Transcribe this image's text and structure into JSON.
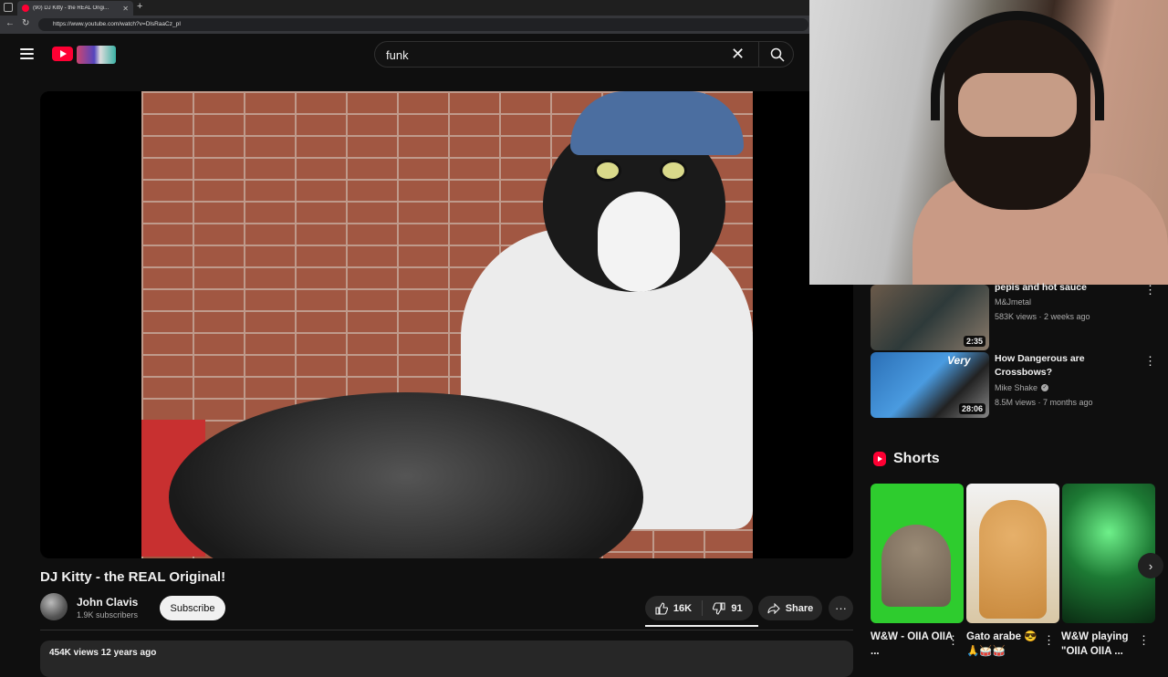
{
  "browser": {
    "tab_title": "(90) DJ Kitty - the REAL Origi...",
    "url": "https://www.youtube.com/watch?v=DlsRaaCz_pI"
  },
  "search": {
    "query": "funk"
  },
  "video": {
    "title": "DJ Kitty - the REAL Original!",
    "channel": "John Clavis",
    "subscribers": "1.9K subscribers",
    "subscribe_label": "Subscribe",
    "likes": "16K",
    "dislikes": "91",
    "share_label": "Share",
    "description_stats": "454K views  12 years ago"
  },
  "recommendations": [
    {
      "title": "pepis and hot sauce",
      "channel": "M&Jmetal",
      "meta": "583K views · 2 weeks ago",
      "duration": "2:35"
    },
    {
      "title": "How Dangerous are Crossbows?",
      "channel": "Mike Shake",
      "meta": "8.5M views · 7 months ago",
      "duration": "28:06",
      "thumb_text": "Very"
    }
  ],
  "shorts": {
    "heading": "Shorts",
    "items": [
      {
        "title": "W&W - OIIA OIIA ..."
      },
      {
        "title": "Gato arabe 😎🙏🥁🥁"
      },
      {
        "title": "W&W playing \"OIIA OIIA ..."
      }
    ]
  },
  "colors": {
    "brand_red": "#ff0033",
    "background": "#0f0f0f"
  }
}
